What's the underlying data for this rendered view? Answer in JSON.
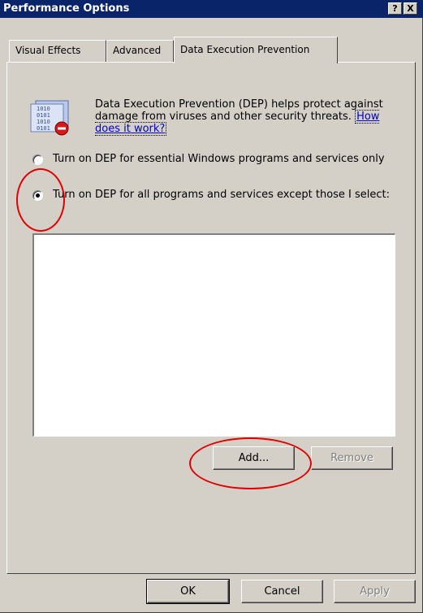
{
  "window": {
    "title": "Performance Options",
    "help_button": "?",
    "close_button": "X"
  },
  "tabs": [
    {
      "label": "Visual Effects"
    },
    {
      "label": "Advanced"
    },
    {
      "label": "Data Execution Prevention",
      "active": true
    }
  ],
  "dep": {
    "description": "Data Execution Prevention (DEP) helps protect against damage from viruses and other security threats.",
    "link_text": "How does it work?",
    "icon": "dep-shield-icon",
    "options": [
      {
        "label": "Turn on DEP for essential Windows programs and services only",
        "checked": false
      },
      {
        "label": "Turn on DEP for all programs and services except those I select:",
        "checked": true
      }
    ],
    "exceptions_list": [],
    "add_button": "Add...",
    "remove_button": "Remove"
  },
  "footer": {
    "ok_label": "OK",
    "cancel_label": "Cancel",
    "apply_label": "Apply"
  },
  "annotation_color": "#e00000"
}
